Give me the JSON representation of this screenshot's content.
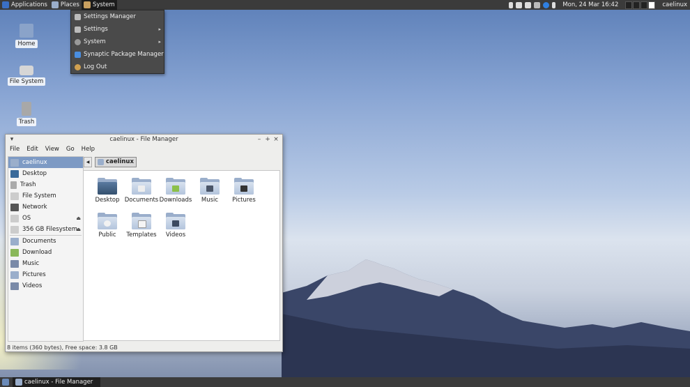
{
  "colors": {
    "panel": "#3b3b3b",
    "menu": "#4a4a4a",
    "selection": "#7d9ac4",
    "folder": "#b3c4dc"
  },
  "top_panel": {
    "applications": "Applications",
    "places": "Places",
    "system": "System",
    "clock": "Mon, 24 Mar  16:42",
    "user": "caelinux"
  },
  "system_menu": {
    "items": [
      {
        "label": "Settings Manager",
        "icon": "settings-manager-icon"
      },
      {
        "label": "Settings",
        "icon": "settings-icon",
        "submenu": true
      },
      {
        "label": "System",
        "icon": "gear-icon",
        "submenu": true
      },
      {
        "label": "Synaptic Package Manager",
        "icon": "synaptic-icon"
      },
      {
        "label": "Log Out",
        "icon": "logout-icon"
      }
    ]
  },
  "desktop_icons": [
    {
      "label": "Home",
      "icon": "home-folder-icon"
    },
    {
      "label": "File System",
      "icon": "drive-icon"
    },
    {
      "label": "Trash",
      "icon": "trash-icon"
    }
  ],
  "file_manager": {
    "title": "caelinux - File Manager",
    "menu": [
      "File",
      "Edit",
      "View",
      "Go",
      "Help"
    ],
    "sidebar": [
      {
        "label": "caelinux",
        "icon": "home-icon",
        "selected": true
      },
      {
        "label": "Desktop",
        "icon": "desktop-icon"
      },
      {
        "label": "Trash",
        "icon": "trash-icon"
      },
      {
        "label": "File System",
        "icon": "drive-icon"
      },
      {
        "label": "Network",
        "icon": "network-icon"
      },
      {
        "label": "OS",
        "icon": "drive-icon",
        "eject": true
      },
      {
        "label": "356 GB Filesystem",
        "icon": "drive-icon",
        "eject": true
      },
      {
        "label": "Documents",
        "icon": "folder-icon"
      },
      {
        "label": "Download",
        "icon": "folder-icon"
      },
      {
        "label": "Music",
        "icon": "folder-icon"
      },
      {
        "label": "Pictures",
        "icon": "folder-icon"
      },
      {
        "label": "Videos",
        "icon": "folder-icon"
      }
    ],
    "path": "caelinux",
    "files": [
      {
        "name": "Desktop",
        "icon": "desktop-folder-icon"
      },
      {
        "name": "Documents",
        "icon": "documents-folder-icon"
      },
      {
        "name": "Downloads",
        "icon": "downloads-folder-icon"
      },
      {
        "name": "Music",
        "icon": "music-folder-icon"
      },
      {
        "name": "Pictures",
        "icon": "pictures-folder-icon"
      },
      {
        "name": "Public",
        "icon": "public-folder-icon"
      },
      {
        "name": "Templates",
        "icon": "templates-folder-icon"
      },
      {
        "name": "Videos",
        "icon": "videos-folder-icon"
      }
    ],
    "status": "8 items (360 bytes), Free space: 3.8 GB"
  },
  "taskbar": {
    "task_label": "caelinux - File Manager"
  }
}
